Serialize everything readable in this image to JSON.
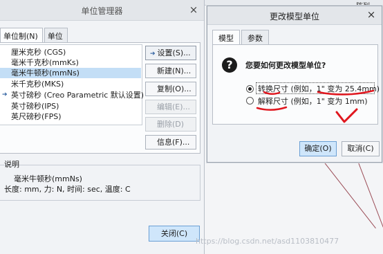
{
  "unit_manager": {
    "title": "单位管理器",
    "close_glyph": "×",
    "tabs": [
      "单位制(N)",
      "单位"
    ],
    "systems": [
      {
        "label": "厘米克秒 (CGS)",
        "selected": false,
        "current": false
      },
      {
        "label": "毫米千克秒(mmKs)",
        "selected": false,
        "current": false
      },
      {
        "label": "毫米牛顿秒(mmNs)",
        "selected": true,
        "current": false
      },
      {
        "label": "米千克秒(MKS)",
        "selected": false,
        "current": false
      },
      {
        "label": "英寸磅秒 (Creo Parametric 默认设置)",
        "selected": false,
        "current": true
      },
      {
        "label": "英寸磅秒(IPS)",
        "selected": false,
        "current": false
      },
      {
        "label": "英尺磅秒(FPS)",
        "selected": false,
        "current": false
      }
    ],
    "buttons": {
      "set": "设置(S)...",
      "new": "新建(N)...",
      "copy": "复制(O)...",
      "edit": "编辑(E)...",
      "delete": "删除(D)",
      "info": "信息(F)..."
    },
    "description_label": "说明",
    "description_name": "毫米牛顿秒(mmNs)",
    "description_detail": "长度: mm, 力: N, 时间: sec, 温度: C",
    "close_button": "关闭(C)"
  },
  "change_model_unit": {
    "title": "更改模型单位",
    "close_glyph": "×",
    "tabs": [
      "模型",
      "参数"
    ],
    "question": "您要如何更改模型单位?",
    "options": [
      {
        "label": "转换尺寸 (例如，1\" 变为 25.4mm)",
        "checked": true
      },
      {
        "label": "解释尺寸 (例如，1\" 变为 1mm)",
        "checked": false
      }
    ],
    "ok": "确定(O)",
    "cancel": "取消(C)"
  },
  "background": {
    "tab_label": "阵列"
  },
  "watermark": "https://blog.csdn.net/asd1103810477",
  "colors": {
    "accent": "#2a5d9e",
    "selection": "#c3def6",
    "primary_button": "#cfe6fb",
    "annotation_red": "#e0161e"
  },
  "icons": {
    "question": "question-mark-icon",
    "current_marker": "arrow-right-icon"
  }
}
